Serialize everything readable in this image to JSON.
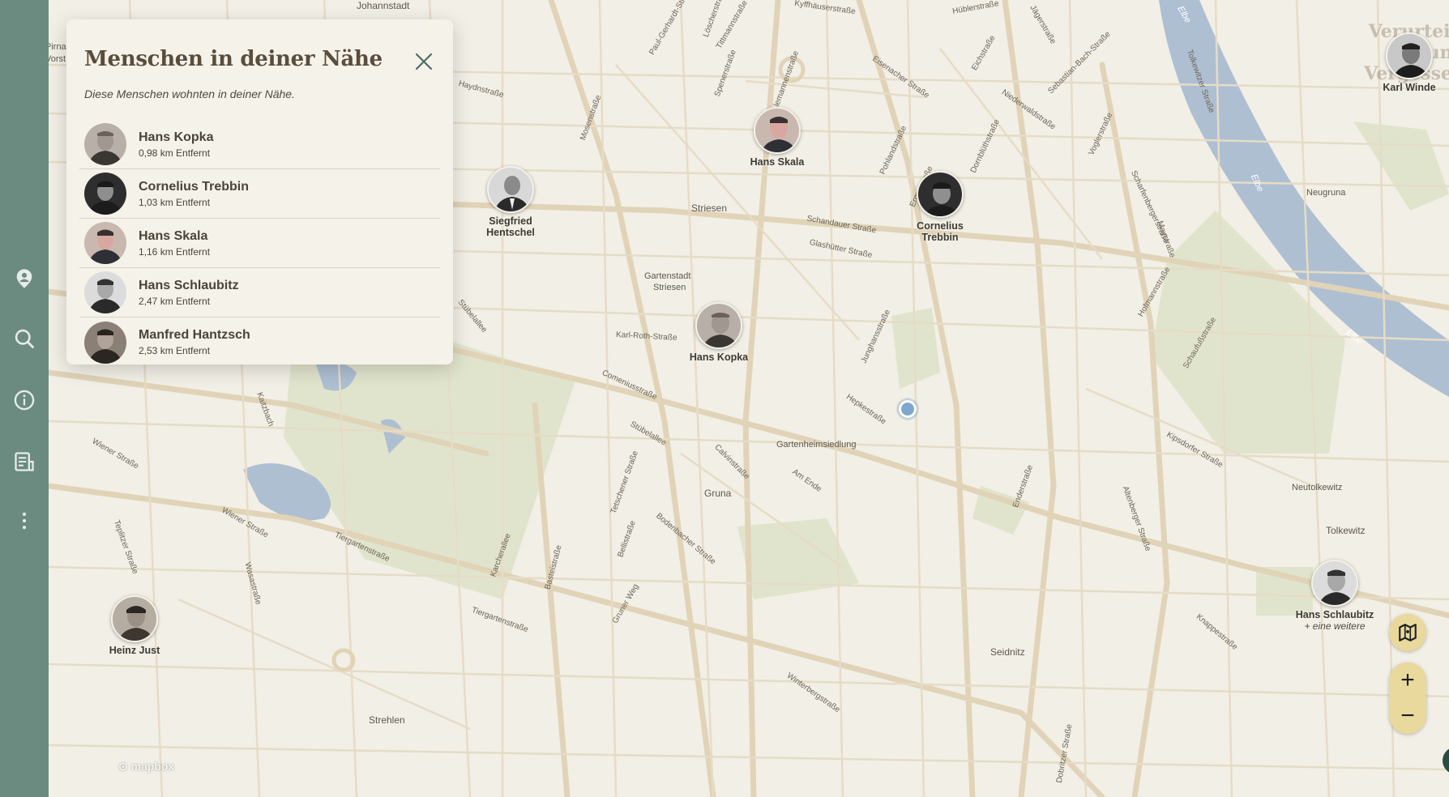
{
  "sidebar": {
    "items": [
      {
        "icon": "location-person-icon"
      },
      {
        "icon": "search-icon"
      },
      {
        "icon": "info-icon"
      },
      {
        "icon": "document-icon"
      },
      {
        "icon": "more-vertical-icon"
      }
    ]
  },
  "panel": {
    "title": "Menschen in deiner Nähe",
    "subtitle": "Diese Menschen wohnten in deiner Nähe.",
    "people": [
      {
        "name": "Hans Kopka",
        "distance": "0,98 km Entfernt"
      },
      {
        "name": "Cornelius Trebbin",
        "distance": "1,03 km Entfernt"
      },
      {
        "name": "Hans Skala",
        "distance": "1,16 km Entfernt"
      },
      {
        "name": "Hans Schlaubitz",
        "distance": "2,47 km Entfernt"
      },
      {
        "name": "Manfred Hantzsch",
        "distance": "2,53 km Entfernt"
      }
    ]
  },
  "markers": {
    "siegfried": {
      "line1": "Siegfried",
      "line2": "Hentschel"
    },
    "skala": {
      "line1": "Hans Skala"
    },
    "trebbin": {
      "line1": "Cornelius",
      "line2": "Trebbin"
    },
    "kopka": {
      "line1": "Hans Kopka"
    },
    "winde": {
      "line1": "Karl Winde"
    },
    "schlaubitz": {
      "line1": "Hans Schlaubitz",
      "more": "+ eine weitere"
    },
    "just": {
      "line1": "Heinz Just"
    }
  },
  "map": {
    "places": {
      "johannstadt": "Johannstadt",
      "striesen": "Striesen",
      "gartenstadt1": "Gartenstadt",
      "gartenstadt2": "Striesen",
      "neugruna": "Neugruna",
      "gartenheimsiedlung": "Gartenheimsiedlung",
      "gruna": "Gruna",
      "neutolkewitz": "Neutolkewitz",
      "tolkewitz": "Tolkewitz",
      "seidnitz": "Seidnitz",
      "strehlen": "Strehlen"
    },
    "streets": {
      "kyffhaeuser": "Kyffhäuserstraße",
      "huebler": "Hüblerstraße",
      "eisenacher": "Eisenacher Straße",
      "eichstrasse": "Eichstraße",
      "sebastian": "Sebastian-Bach-Straße",
      "niederwald": "Niederwaldstraße",
      "schandauer": "Schandauer Straße",
      "glashuetter": "Glashütter Straße",
      "karlroth": "Karl-Roth-Straße",
      "comenius": "Comeniusstraße",
      "stuebelallee": "Stübelallee",
      "stuebelallee2": "Stübelallee",
      "tiergarten": "Tiergartenstraße",
      "tiergarten2": "Tiergartenstraße",
      "wiener": "Wiener Straße",
      "wiener2": "Wiener Straße",
      "bodenbacher": "Bodenbacher Straße",
      "winterberg": "Winterbergstraße",
      "kipsdorfer": "Kipsdorfer Straße",
      "hepke": "Hepkestraße",
      "amende": "Am Ende",
      "enderstrasse": "Enderstraße",
      "karcherallee": "Karcherallee",
      "teplitzer": "Teplitzer Straße",
      "haydn": "Haydnstraße",
      "mosen": "Mosenstraße",
      "calvin": "Calvinstraße",
      "pohland": "Pohlandstraße",
      "ermel": "Ermelstraße",
      "dornbluet": "Dornblüthstraße",
      "jungbusch": "Junghansstraße",
      "hofmann": "Hofmannstraße",
      "schaufuss": "Schaufußstraße",
      "altenberger": "Altenberger Straße",
      "knappe": "Knappestraße",
      "wasastrasse": "Wasastraße",
      "gruner": "Gruner Weg",
      "lohrmann": "Lohrmannstraße",
      "dobritzer": "Dobritzer Straße",
      "spenerstrasse": "Spenerstraße",
      "tittmann": "Tittmannstraße",
      "alemann": "Alemannenstraße",
      "scharfen": "Scharfenbergerstraße",
      "voglerstrasse": "Voglerstraße",
      "jaeger": "Jägerstraße",
      "tolkewitzer": "Tolkewitzer Straße",
      "kaitzbach": "Kaitzbach",
      "mayer": "Maystraße",
      "tetschener": "Tetschener Straße",
      "bastei": "Basteistraße",
      "bellistrasse": "Bellistraße",
      "loschwitz": "Löscherstraße",
      "paul": "Paul-Gerhardt-Straße"
    },
    "river": {
      "elbe1": "Elbe",
      "elbe2": "Elbe",
      "elbe3": "Elbe"
    },
    "attribution": "mapbox",
    "partial_left": [
      "Pirna",
      "Vorst"
    ]
  },
  "brand": {
    "line1": "Verurteilt und",
    "line2": "Vergessen"
  },
  "controls": {
    "zoom_in": "+",
    "zoom_out": "−",
    "info": "i"
  },
  "colors": {
    "sidebar": "#6b8b80",
    "map_bg": "#f2efe6",
    "road": "#e2d6bd",
    "water": "#a9bcd0",
    "park": "#dde0c7",
    "panel_bg": "#f5f2ea",
    "control": "#e9d99c"
  }
}
